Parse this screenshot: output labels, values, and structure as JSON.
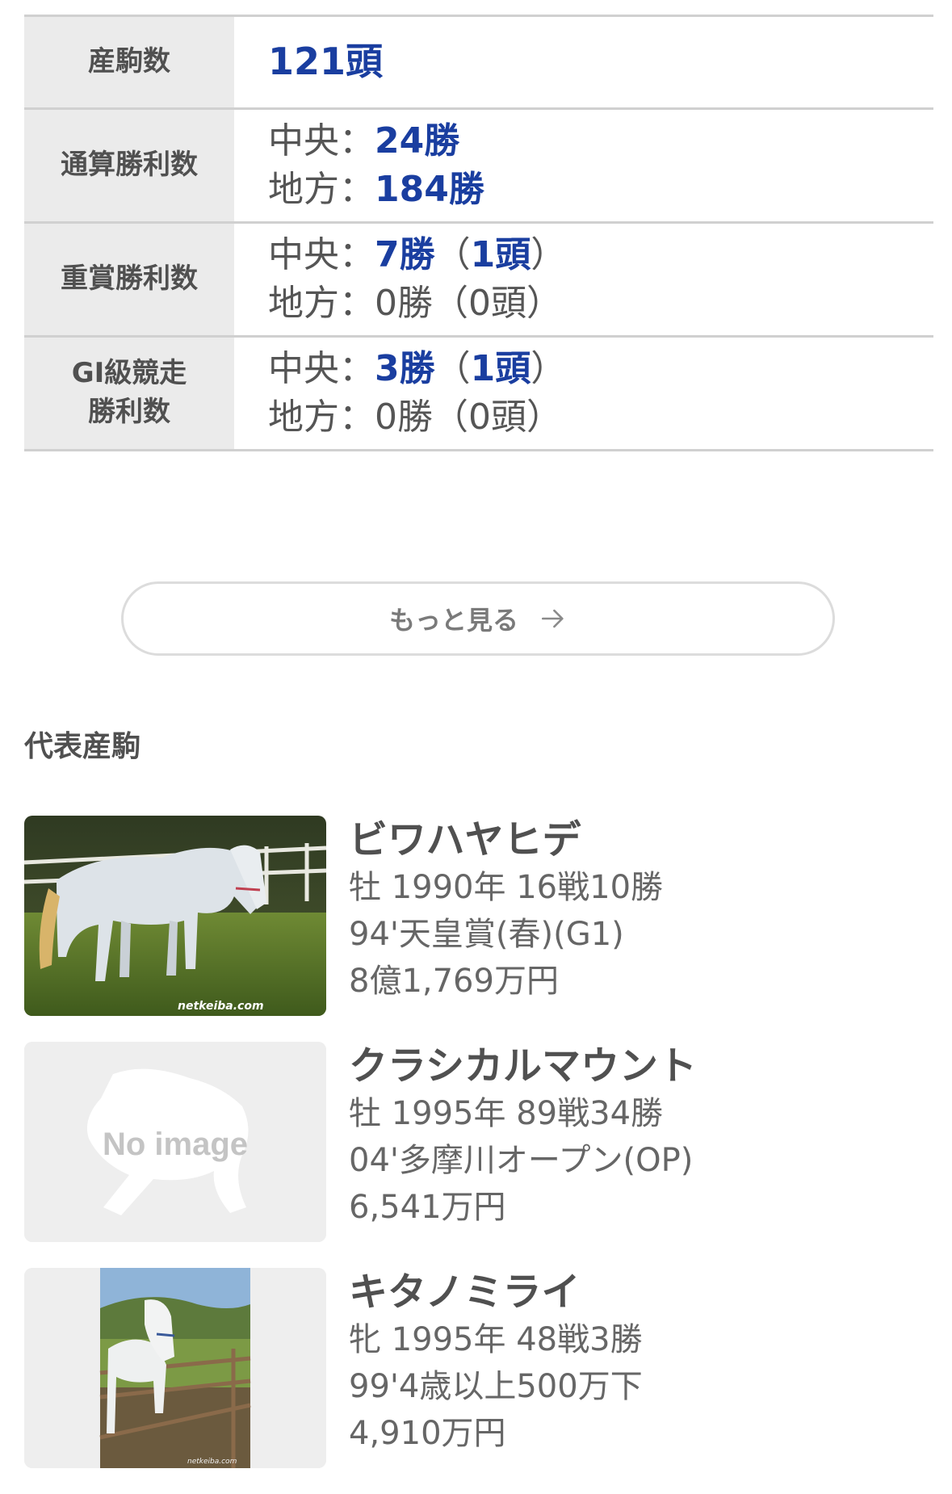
{
  "stats": {
    "offspring": {
      "label": "産駒数",
      "value": "121頭"
    },
    "total_wins": {
      "label": "通算勝利数",
      "chuo_prefix": "中央：",
      "chuo_value": "24勝",
      "chiho_prefix": "地方：",
      "chiho_value": "184勝"
    },
    "graded_wins": {
      "label": "重賞勝利数",
      "chuo_prefix": "中央：",
      "chuo_wins": "7勝",
      "chuo_paren_open": "（",
      "chuo_heads": "1頭",
      "chuo_paren_close": "）",
      "chiho_text": "地方：0勝（0頭）"
    },
    "g1_wins": {
      "label_line1": "GI級競走",
      "label_line2": "勝利数",
      "chuo_prefix": "中央：",
      "chuo_wins": "3勝",
      "chuo_paren_open": "（",
      "chuo_heads": "1頭",
      "chuo_paren_close": "）",
      "chiho_text": "地方：0勝（0頭）"
    }
  },
  "more_button": {
    "label": "もっと見る",
    "icon": "arrow-right-icon"
  },
  "section_title": "代表産駒",
  "horses": [
    {
      "name": "ビワハヤヒデ",
      "profile": "牡 1990年 16戦10勝",
      "major_win": "94'天皇賞(春)(G1)",
      "earnings": "8億1,769万円",
      "photo_caption": "netkeiba.com"
    },
    {
      "name": "クラシカルマウント",
      "profile": "牡 1995年 89戦34勝",
      "major_win": "04'多摩川オープン(OP)",
      "earnings": "6,541万円",
      "placeholder_text": "No image"
    },
    {
      "name": "キタノミライ",
      "profile": "牝 1995年 48戦3勝",
      "major_win": "99'4歳以上500万下",
      "earnings": "4,910万円",
      "photo_caption": "netkeiba.com"
    }
  ],
  "colors": {
    "accent": "#1a3ea0",
    "label_bg": "#ebebeb",
    "border": "#d0d0d0"
  }
}
